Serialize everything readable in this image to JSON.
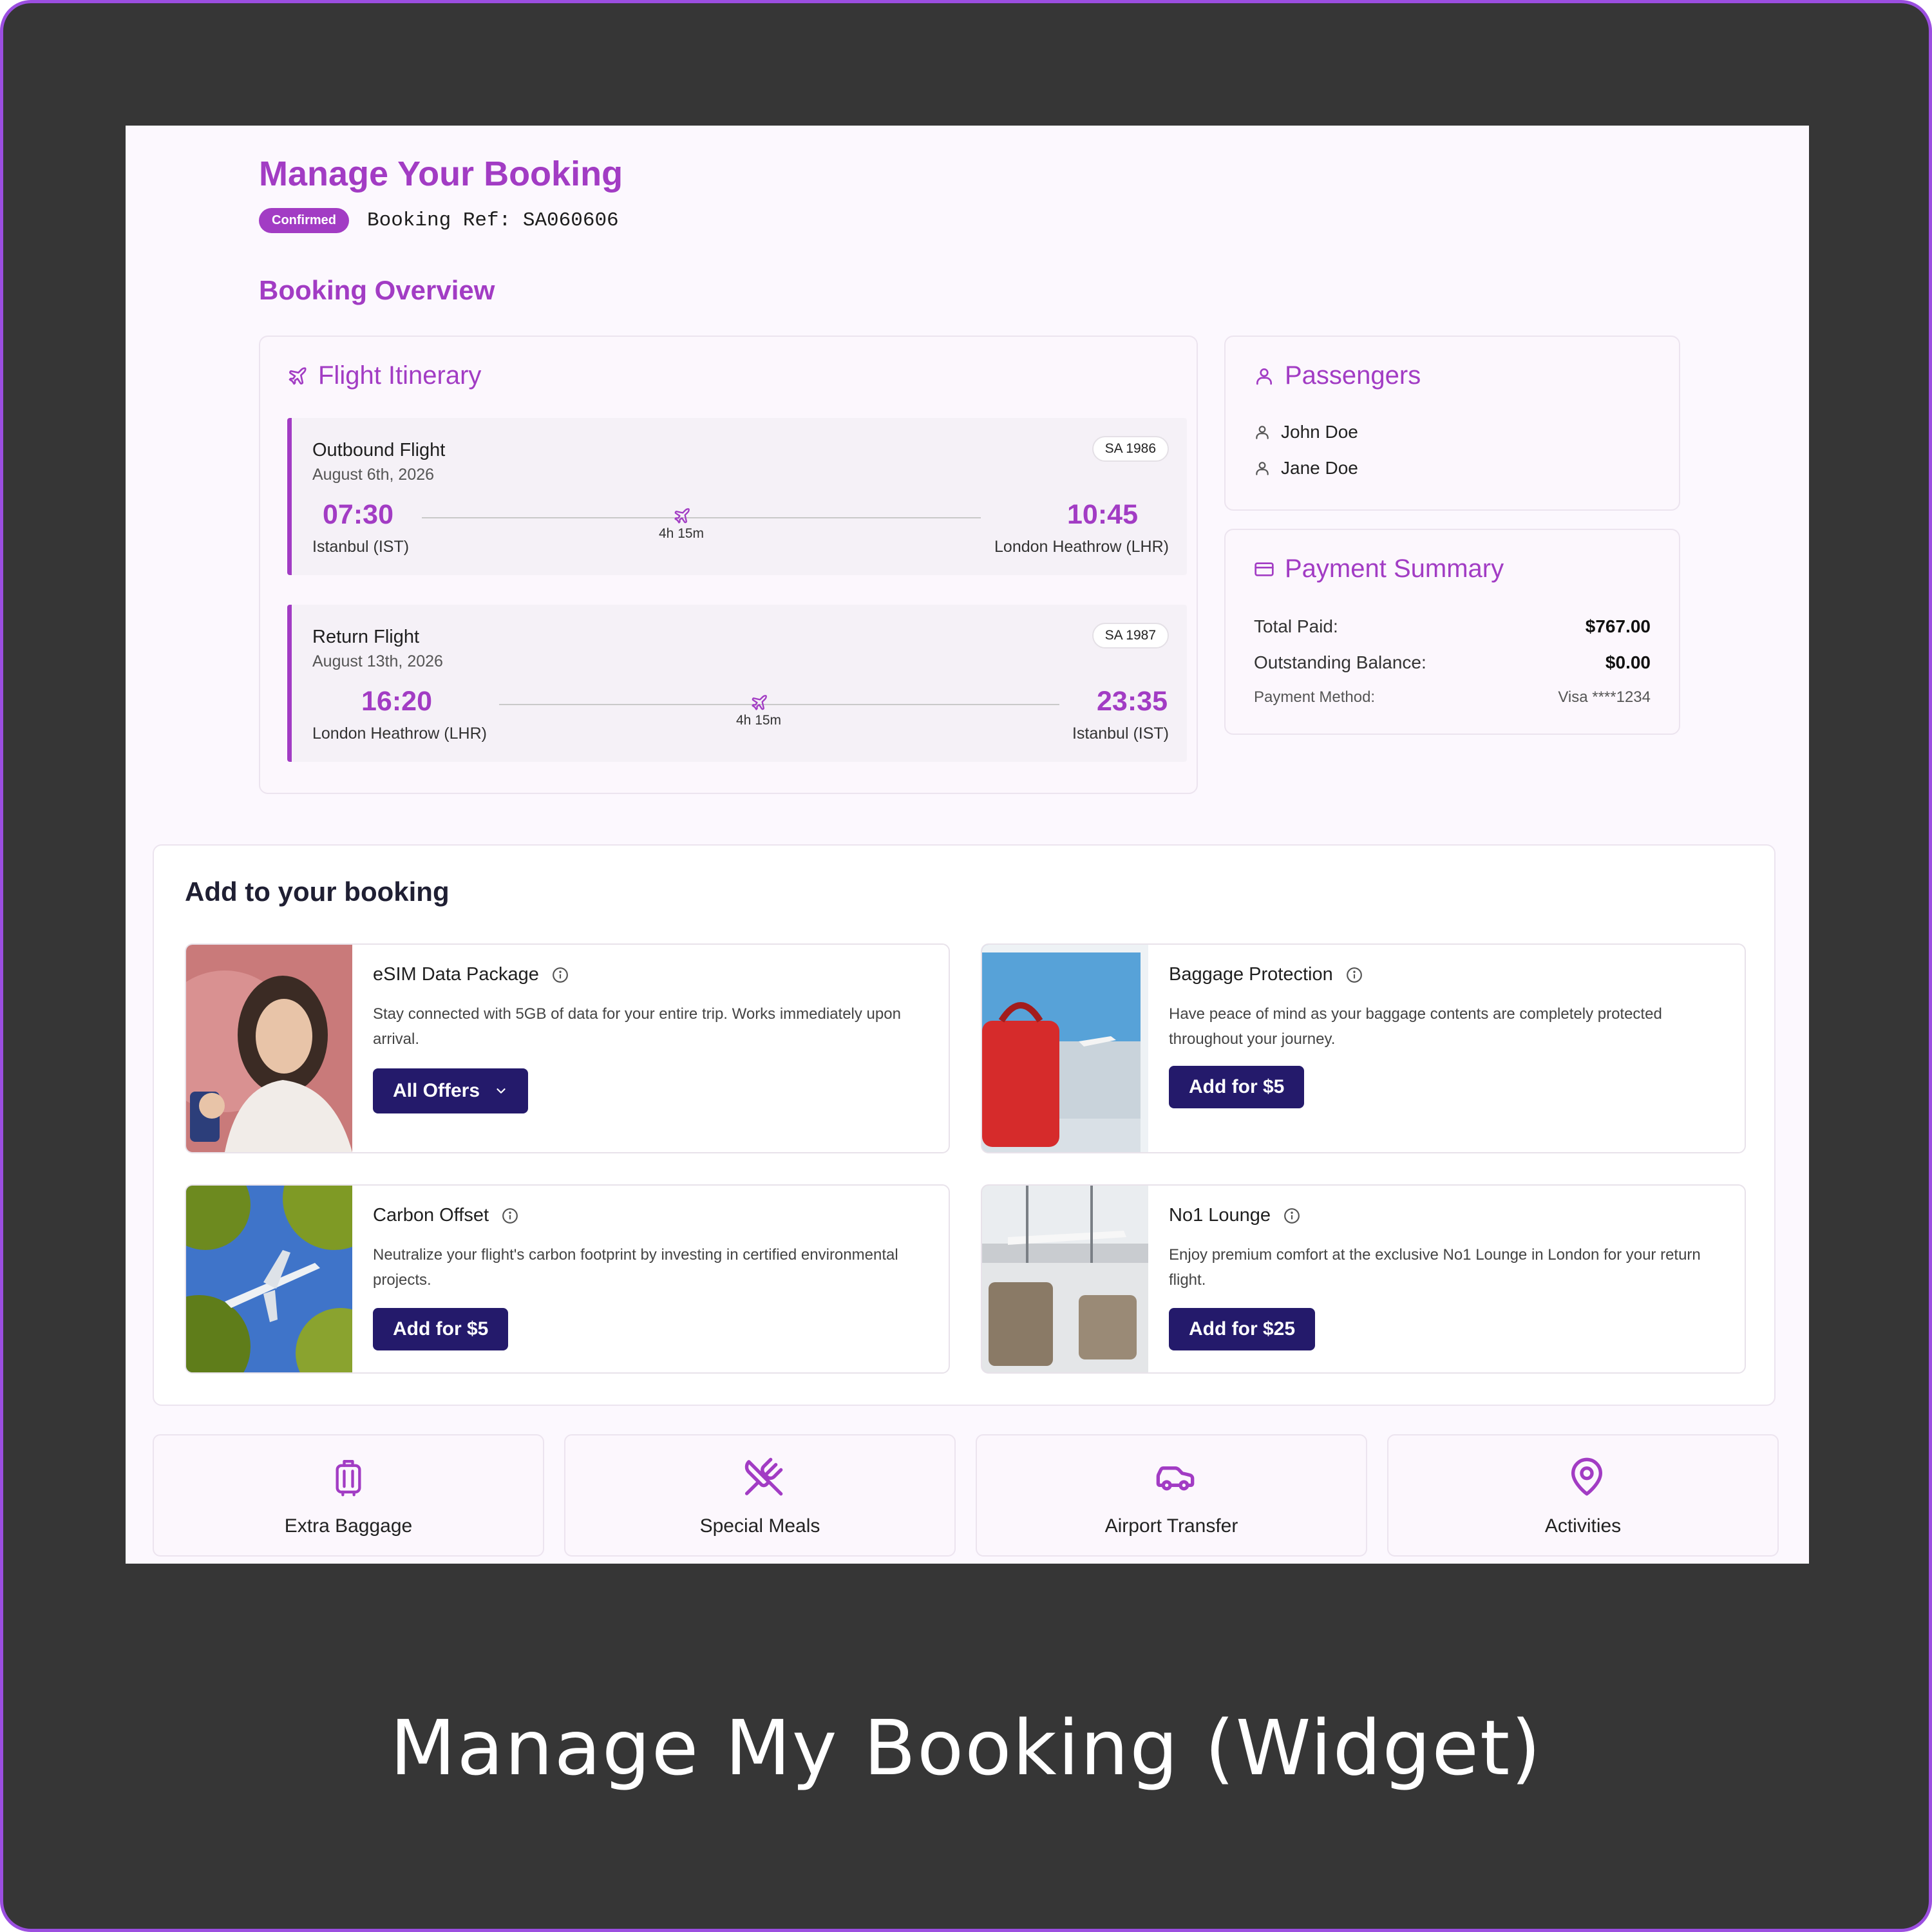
{
  "caption": "Manage My Booking (Widget)",
  "header": {
    "title": "Manage Your Booking",
    "status": "Confirmed",
    "booking_ref": "Booking Ref: SA060606"
  },
  "overview": {
    "title": "Booking Overview",
    "itinerary": {
      "title": "Flight Itinerary",
      "outbound": {
        "label": "Outbound Flight",
        "date": "August 6th, 2026",
        "flight_number": "SA 1986",
        "depart_time": "07:30",
        "depart_airport": "Istanbul (IST)",
        "arrive_time": "10:45",
        "arrive_airport": "London Heathrow (LHR)",
        "duration": "4h 15m"
      },
      "return": {
        "label": "Return Flight",
        "date": "August 13th, 2026",
        "flight_number": "SA 1987",
        "depart_time": "16:20",
        "depart_airport": "London Heathrow (LHR)",
        "arrive_time": "23:35",
        "arrive_airport": "Istanbul (IST)",
        "duration": "4h 15m"
      }
    },
    "passengers": {
      "title": "Passengers",
      "items": [
        "John Doe",
        "Jane Doe"
      ]
    },
    "payment": {
      "title": "Payment Summary",
      "total_label": "Total Paid:",
      "total_value": "$767.00",
      "balance_label": "Outstanding Balance:",
      "balance_value": "$0.00",
      "method_label": "Payment Method:",
      "method_value": "Visa ****1234"
    }
  },
  "addons": {
    "title": "Add to your booking",
    "items": [
      {
        "title": "eSIM Data Package",
        "description": "Stay connected with 5GB of data for your entire trip. Works immediately upon arrival.",
        "button": "All Offers"
      },
      {
        "title": "Baggage Protection",
        "description": "Have peace of mind as your baggage contents are completely protected throughout your journey.",
        "button": "Add for $5"
      },
      {
        "title": "Carbon Offset",
        "description": "Neutralize your flight's carbon footprint by investing in certified environmental projects.",
        "button": "Add for $5"
      },
      {
        "title": "No1 Lounge",
        "description": "Enjoy premium comfort at the exclusive No1 Lounge in London for your return flight.",
        "button": "Add for $25"
      }
    ]
  },
  "services": [
    "Extra Baggage",
    "Special Meals",
    "Airport Transfer",
    "Activities"
  ],
  "icons": {
    "itinerary": "plane-icon",
    "passenger": "user-icon",
    "payment": "credit-card-icon",
    "info": "info-icon",
    "dropdown": "chevron-down-icon",
    "services": [
      "luggage-icon",
      "utensils-icon",
      "car-icon",
      "map-pin-icon"
    ]
  },
  "colors": {
    "accent": "#a23cc4",
    "button": "#241a6b",
    "frame": "#363636",
    "frame_border": "#9b4ee0"
  }
}
